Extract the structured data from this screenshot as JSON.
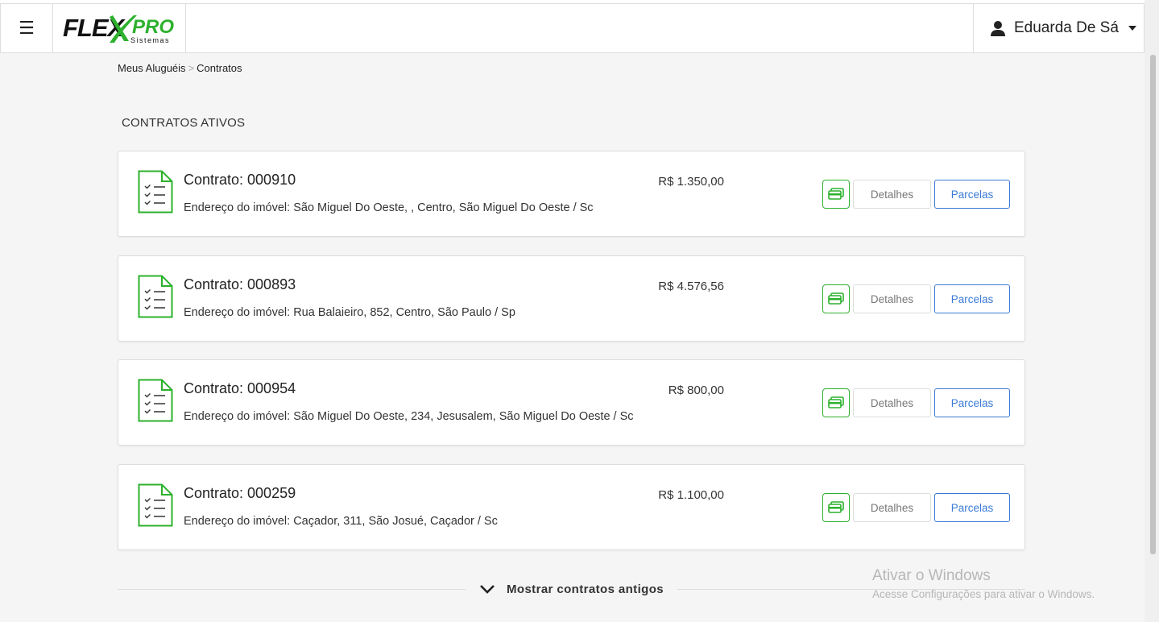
{
  "header": {
    "menu_icon": "hamburger-icon",
    "logo_main_left": "FLEX",
    "logo_main_right": "PRO",
    "logo_sub": "Sistemas",
    "brand_color": "#2db12d",
    "user_name": "Eduarda De Sá",
    "user_icon": "user-icon"
  },
  "breadcrumb": {
    "items": [
      "Meus Aluguéis",
      "Contratos"
    ],
    "separator": ">"
  },
  "section_title": "CONTRATOS ATIVOS",
  "contracts": [
    {
      "title": "Contrato: 000910",
      "address": "Endereço do imóvel: São Miguel Do Oeste, , Centro, São Miguel Do Oeste / Sc",
      "value": "R$  1.350,00",
      "details_label": "Detalhes",
      "parcelas_label": "Parcelas"
    },
    {
      "title": "Contrato: 000893",
      "address": "Endereço do imóvel: Rua Balaieiro, 852, Centro, São Paulo / Sp",
      "value": "R$  4.576,56",
      "details_label": "Detalhes",
      "parcelas_label": "Parcelas"
    },
    {
      "title": "Contrato: 000954",
      "address": "Endereço do imóvel: São Miguel Do Oeste, 234, Jesusalem, São Miguel Do Oeste / Sc",
      "value": "R$  800,00",
      "details_label": "Detalhes",
      "parcelas_label": "Parcelas"
    },
    {
      "title": "Contrato: 000259",
      "address": "Endereço do imóvel: Caçador, 311, São Josué, Caçador / Sc",
      "value": "R$  1.100,00",
      "details_label": "Detalhes",
      "parcelas_label": "Parcelas"
    }
  ],
  "show_older_label": "Mostrar contratos antigos",
  "windows_watermark": {
    "title": "Ativar o Windows",
    "subtitle": "Acesse Configurações para ativar o Windows."
  },
  "colors": {
    "accent_green": "#2db12d",
    "link_blue": "#3a7bd5",
    "background": "#f5f5f5"
  }
}
